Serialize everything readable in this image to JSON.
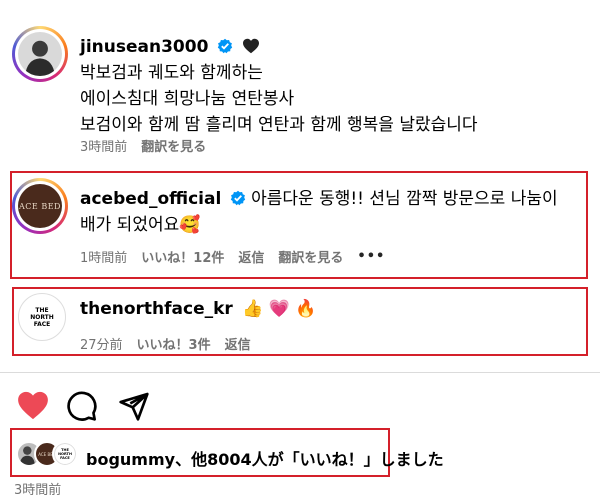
{
  "post": {
    "username": "jinusean3000",
    "lines": [
      "박보검과 궤도와 함께하는",
      "에이스침대 희망나눔 연탄봉사",
      "보검이와 함께 땀 흘리며 연탄과 함께 행복을 날랐습니다"
    ],
    "time": "3時間前",
    "translate": "翻訳を見る"
  },
  "comments": [
    {
      "username": "acebed_official",
      "avatar_text": "ACE BED",
      "text_line1": "아름다운 동행!! 션님 깜짝 방문으로 나눔이",
      "text_line2": "배가 되었어요",
      "emoji": "🥰",
      "time": "1時間前",
      "likes": "いいね！12件",
      "reply": "返信",
      "translate": "翻訳を見る",
      "more": "•••"
    },
    {
      "username": "thenorthface_kr",
      "avatar_text": "THE NORTH FACE",
      "emojis": "👍 💗 🔥",
      "time": "27分前",
      "likes": "いいね！3件",
      "reply": "返信"
    }
  ],
  "likes_summary": {
    "text": "bogummy、他8004人が「いいね！」しました",
    "mini_avatar_text": "ACE BED",
    "mini_avatar2_text": "THE NORTH FACE",
    "time": "3時間前"
  },
  "colors": {
    "heart": "#ed4956",
    "verified": "#0095f6",
    "highlight": "#d4202a",
    "acebed": "#4a2a1c"
  },
  "icons": [
    "heart-icon",
    "comment-icon",
    "share-icon",
    "verified-icon",
    "black-heart-icon"
  ]
}
